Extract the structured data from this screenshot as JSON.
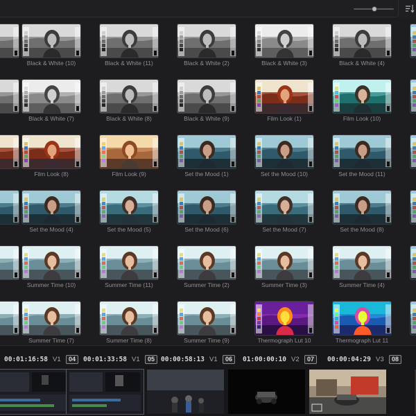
{
  "toolbar": {
    "zoom_level": 0.5,
    "sort_icon": "sort-list-icon"
  },
  "gallery": {
    "rows": [
      [
        {
          "label": "",
          "style": "bw"
        },
        {
          "label": "Black & White  (10)",
          "style": "bw"
        },
        {
          "label": "Black & White  (11)",
          "style": "bw"
        },
        {
          "label": "Black & White  (2)",
          "style": "bw"
        },
        {
          "label": "Black & White  (3)",
          "style": "bw2"
        },
        {
          "label": "Black & White  (4)",
          "style": "bw"
        }
      ],
      [
        {
          "label": "",
          "style": "bw"
        },
        {
          "label": "Black & White  (7)",
          "style": "bw2"
        },
        {
          "label": "Black & White  (8)",
          "style": "bw"
        },
        {
          "label": "Black & White  (9)",
          "style": "bw"
        },
        {
          "label": "Film Look (1)",
          "style": "film"
        },
        {
          "label": "Film Look (10)",
          "style": "teal"
        }
      ],
      [
        {
          "label": "",
          "style": "film"
        },
        {
          "label": "Film Look (8)",
          "style": "film"
        },
        {
          "label": "Film Look (9)",
          "style": "warm"
        },
        {
          "label": "Set the Mood (1)",
          "style": "mood"
        },
        {
          "label": "Set the Mood (10)",
          "style": "mood"
        },
        {
          "label": "Set the Mood (11)",
          "style": "mood"
        }
      ],
      [
        {
          "label": "",
          "style": "mood"
        },
        {
          "label": "Set the Mood (4)",
          "style": "mood"
        },
        {
          "label": "Set the Mood (5)",
          "style": "mood2"
        },
        {
          "label": "Set the Mood (6)",
          "style": "mood"
        },
        {
          "label": "Set the Mood (7)",
          "style": "mood2"
        },
        {
          "label": "Set the Mood (8)",
          "style": "mood"
        }
      ],
      [
        {
          "label": "",
          "style": "summer"
        },
        {
          "label": "Summer Time (10)",
          "style": "summer"
        },
        {
          "label": "Summer Time (11)",
          "style": "summer"
        },
        {
          "label": "Summer Time (2)",
          "style": "summer"
        },
        {
          "label": "Summer Time (3)",
          "style": "summer"
        },
        {
          "label": "Summer Time (4)",
          "style": "summer"
        }
      ],
      [
        {
          "label": "",
          "style": "summer"
        },
        {
          "label": "Summer Time (7)",
          "style": "summer"
        },
        {
          "label": "Summer Time (8)",
          "style": "summer"
        },
        {
          "label": "Summer Time (9)",
          "style": "summer"
        },
        {
          "label": "Thermograph Lut 10",
          "style": "thermo"
        },
        {
          "label": "Thermograph Lut 11",
          "style": "thermo2"
        }
      ]
    ]
  },
  "timeline": {
    "clips": [
      {
        "timecode": "00:01:16:58",
        "track": "V1",
        "number": "04"
      },
      {
        "timecode": "00:01:33:58",
        "track": "V1",
        "number": "05"
      },
      {
        "timecode": "00:00:58:13",
        "track": "V1",
        "number": "06"
      },
      {
        "timecode": "01:00:00:10",
        "track": "V2",
        "number": "07"
      },
      {
        "timecode": "00:00:04:29",
        "track": "V3",
        "number": "08"
      }
    ]
  }
}
